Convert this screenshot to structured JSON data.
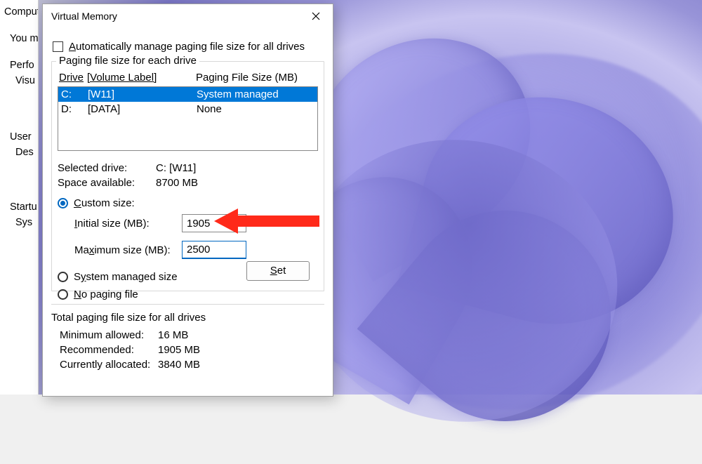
{
  "bgwin": {
    "l1": "Compute",
    "l2": "You m",
    "l3": "Perfo",
    "l4": "Visu",
    "l5": "User",
    "l6": "Des",
    "l7": "Startu",
    "l8": "Sys"
  },
  "dialog": {
    "title": "Virtual Memory",
    "auto_manage": "Automatically manage paging file size for all drives",
    "group_legend": "Paging file size for each drive",
    "headers": {
      "drive": "Drive",
      "label": "[Volume Label]",
      "size": "Paging File Size (MB)"
    },
    "drives": [
      {
        "letter": "C:",
        "label": "[W11]",
        "size": "System managed",
        "selected": true
      },
      {
        "letter": "D:",
        "label": "[DATA]",
        "size": "None",
        "selected": false
      }
    ],
    "selected_drive_label": "Selected drive:",
    "selected_drive_value": "C:  [W11]",
    "space_available_label": "Space available:",
    "space_available_value": "8700 MB",
    "custom_size_label": "Custom size:",
    "initial_size_label": "Initial size (MB):",
    "initial_size_value": "1905",
    "maximum_size_label": "Maximum size (MB):",
    "maximum_size_value": "2500",
    "system_managed_label": "System managed size",
    "no_paging_label": "No paging file",
    "set_button": "Set",
    "totals_heading": "Total paging file size for all drives",
    "min_allowed_label": "Minimum allowed:",
    "min_allowed_value": "16 MB",
    "recommended_label": "Recommended:",
    "recommended_value": "1905 MB",
    "currently_allocated_label": "Currently allocated:",
    "currently_allocated_value": "3840 MB"
  }
}
